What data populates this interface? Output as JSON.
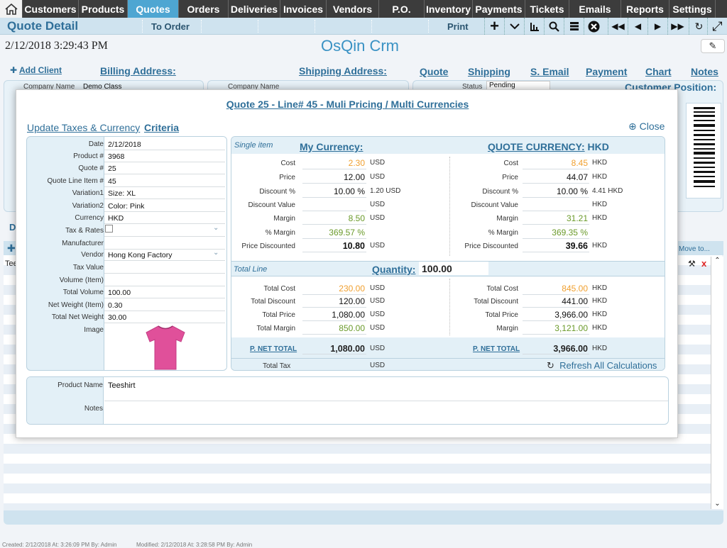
{
  "nav": {
    "items": [
      "Customers",
      "Products",
      "Quotes",
      "Orders",
      "Deliveries",
      "Invoices",
      "Vendors",
      "P.O.",
      "Inventory",
      "Payments",
      "Tickets",
      "Emails",
      "Reports",
      "Settings"
    ],
    "active": "Quotes"
  },
  "subbar": {
    "title": "Quote Detail",
    "to_order": "To Order",
    "print": "Print"
  },
  "datetime": "2/12/2018 3:29:43 PM",
  "app_name": "OsQin Crm",
  "header": {
    "add_client": "Add Client",
    "billing": "Billing Address:",
    "shipping": "Shipping Address:",
    "tabs": [
      "Quote",
      "Shipping",
      "S. Email",
      "Payment",
      "Chart",
      "Notes"
    ]
  },
  "background": {
    "company_label": "Company Name",
    "company_value": "Demo Class",
    "company_label2": "Company Name",
    "status_label": "Status",
    "status_value": "Pending",
    "customer_position": "Customer Position:",
    "move_to": "Move to...",
    "tab_letter": "D",
    "row_text": "Tee"
  },
  "modal": {
    "title": "Quote 25 - Line# 45 - Muli Pricing / Multi Currencies",
    "update_taxes": "Update Taxes & Currency",
    "criteria": "Criteria",
    "close": "Close",
    "fields": [
      {
        "label": "Date",
        "value": "2/12/2018"
      },
      {
        "label": "Product #",
        "value": "3968"
      },
      {
        "label": "Quote #",
        "value": "25"
      },
      {
        "label": "Quote Line Item #",
        "value": "45"
      },
      {
        "label": "Variation1",
        "value": "Size: XL"
      },
      {
        "label": "Variation2",
        "value": "Color: Pink"
      },
      {
        "label": "Currency",
        "value": "HKD"
      },
      {
        "label": "Tax & Rates",
        "value": ""
      },
      {
        "label": "Manufacturer",
        "value": ""
      },
      {
        "label": "Vendor",
        "value": "Hong Kong Factory"
      },
      {
        "label": "Tax Value",
        "value": ""
      },
      {
        "label": "Volume (Item)",
        "value": ""
      },
      {
        "label": "Total Volume",
        "value": "100.00"
      },
      {
        "label": "Net Weight (Item)",
        "value": "0.30"
      },
      {
        "label": "Total Net Weight",
        "value": "30.00"
      },
      {
        "label": "Image",
        "value": ""
      }
    ],
    "pricing": {
      "single_item": "Single item",
      "my_currency": "My Currency:",
      "quote_currency": "QUOTE CURRENCY:",
      "quote_currency_code": "HKD",
      "left_rows": [
        {
          "label": "Cost",
          "value": "2.30",
          "unit": "USD",
          "color": "orange"
        },
        {
          "label": "Price",
          "value": "12.00",
          "unit": "USD",
          "color": "black"
        },
        {
          "label": "Discount %",
          "value": "10.00 %",
          "unit": "1.20 USD",
          "color": "black"
        },
        {
          "label": "Discount Value",
          "value": "",
          "unit": "USD",
          "color": "black"
        },
        {
          "label": "Margin",
          "value": "8.50",
          "unit": "USD",
          "color": "green"
        },
        {
          "label": "% Margin",
          "value": "369.57 %",
          "unit": "",
          "color": "green"
        },
        {
          "label": "Price Discounted",
          "value": "10.80",
          "unit": "USD",
          "color": "bold"
        }
      ],
      "right_rows": [
        {
          "label": "Cost",
          "value": "8.45",
          "unit": "HKD",
          "color": "orange"
        },
        {
          "label": "Price",
          "value": "44.07",
          "unit": "HKD",
          "color": "black"
        },
        {
          "label": "Discount %",
          "value": "10.00 %",
          "unit": "4.41 HKD",
          "color": "black"
        },
        {
          "label": "Discount Value",
          "value": "",
          "unit": "HKD",
          "color": "black"
        },
        {
          "label": "Margin",
          "value": "31.21",
          "unit": "HKD",
          "color": "green"
        },
        {
          "label": "% Margin",
          "value": "369.35 %",
          "unit": "",
          "color": "green"
        },
        {
          "label": "Price Discounted",
          "value": "39.66",
          "unit": "HKD",
          "color": "bold"
        }
      ],
      "total_line": "Total Line",
      "quantity_label": "Quantity:",
      "quantity_value": "100.00",
      "left_totals": [
        {
          "label": "Total Cost",
          "value": "230.00",
          "unit": "USD",
          "color": "orange"
        },
        {
          "label": "Total Discount",
          "value": "120.00",
          "unit": "USD",
          "color": "black"
        },
        {
          "label": "Total Price",
          "value": "1,080.00",
          "unit": "USD",
          "color": "black"
        },
        {
          "label": "Total Margin",
          "value": "850.00",
          "unit": "USD",
          "color": "green"
        }
      ],
      "right_totals": [
        {
          "label": "Total Cost",
          "value": "845.00",
          "unit": "HKD",
          "color": "orange"
        },
        {
          "label": "Total Discount",
          "value": "441.00",
          "unit": "HKD",
          "color": "black"
        },
        {
          "label": "Total Price",
          "value": "3,966.00",
          "unit": "HKD",
          "color": "black"
        },
        {
          "label": "Margin",
          "value": "3,121.00",
          "unit": "HKD",
          "color": "green"
        }
      ],
      "p_net_total_label": "P. NET TOTAL",
      "left_net_total": "1,080.00",
      "left_net_unit": "USD",
      "right_net_total": "3,966.00",
      "right_net_unit": "HKD",
      "total_tax": "Total Tax",
      "total_tax_unit": "USD",
      "refresh": "Refresh All Calculations"
    },
    "product_name_label": "Product Name",
    "product_name": "Teeshirt",
    "notes_label": "Notes"
  },
  "footer": {
    "created": "Created: 2/12/2018  At:  3:26:09 PM  By: Admin",
    "modified": "Modified: 2/12/2018  At:  3:28:58 PM  By: Admin"
  },
  "colors": {
    "nav_bg": "#3c3c3c",
    "nav_active": "#4ea6d2",
    "accent": "#2f6f99",
    "orange": "#f0a030",
    "green": "#6a9a2a"
  }
}
